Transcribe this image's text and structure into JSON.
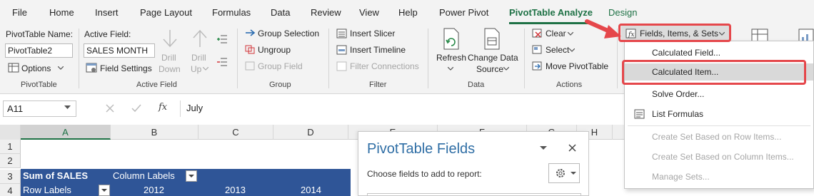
{
  "tabs": [
    "File",
    "Home",
    "Insert",
    "Page Layout",
    "Formulas",
    "Data",
    "Review",
    "View",
    "Help",
    "Power Pivot",
    "PivotTable Analyze",
    "Design"
  ],
  "pivottable_group": {
    "name_label": "PivotTable Name:",
    "name_value": "PivotTable2",
    "options_label": "Options",
    "group_label": "PivotTable"
  },
  "active_field_group": {
    "label": "Active Field:",
    "value": "SALES MONTH",
    "field_settings": "Field Settings",
    "drill_down_1": "Drill",
    "drill_down_2": "Down",
    "drill_up_1": "Drill",
    "drill_up_2": "Up",
    "group_label": "Active Field"
  },
  "group_group": {
    "group_selection": "Group Selection",
    "ungroup": "Ungroup",
    "group_field": "Group Field",
    "group_label": "Group"
  },
  "filter_group": {
    "insert_slicer": "Insert Slicer",
    "insert_timeline": "Insert Timeline",
    "filter_connections": "Filter Connections",
    "group_label": "Filter"
  },
  "data_group": {
    "refresh": "Refresh",
    "change_1": "Change Data",
    "change_2": "Source",
    "group_label": "Data"
  },
  "actions_group": {
    "clear": "Clear",
    "select": "Select",
    "move": "Move PivotTable",
    "group_label": "Actions"
  },
  "calc_button": {
    "label": "Fields, Items, & Sets"
  },
  "formula_bar": {
    "name_box": "A11",
    "fx": "fx",
    "formula": "July"
  },
  "columns": [
    "A",
    "B",
    "C",
    "D",
    "E",
    "F",
    "G",
    "H"
  ],
  "rows": [
    "1",
    "2",
    "3",
    "4"
  ],
  "pivot": {
    "sum_label": "Sum of SALES",
    "column_labels": "Column Labels",
    "row_labels": "Row Labels",
    "year_2012": "2012",
    "year_2013": "2013",
    "year_2014": "2014"
  },
  "pane": {
    "title": "PivotTable Fields",
    "subtitle": "Choose fields to add to report:"
  },
  "menu": {
    "calculated_field": "Calculated Field...",
    "calculated_item": "Calculated Item...",
    "solve_order": "Solve Order...",
    "list_formulas": "List Formulas",
    "set_rows": "Create Set Based on Row Items...",
    "set_cols": "Create Set Based on Column Items...",
    "manage_sets": "Manage Sets..."
  },
  "colors": {
    "accent": "#1e7145",
    "pivot_header": "#2f5597",
    "highlight": "#e5474b"
  }
}
